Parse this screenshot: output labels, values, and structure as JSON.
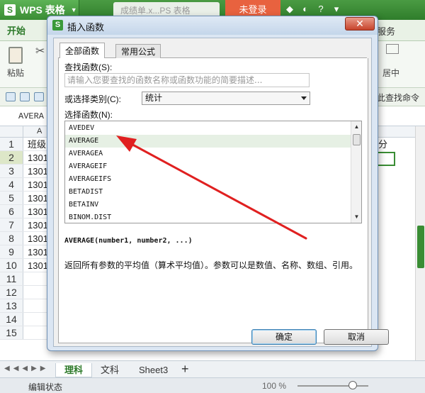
{
  "app": {
    "name": "WPS 表格",
    "logo_glyph": "S",
    "doc_tab": "成绩单.x...PS 表格",
    "login": "未登录",
    "accent": "#3a8d34"
  },
  "ribbon": {
    "tab_start": "开始",
    "tab_service": "服务",
    "paste": "粘贴",
    "center": "居中",
    "find_command": "此查找命令"
  },
  "formula": {
    "name_box": "AVERA"
  },
  "sheet": {
    "col_a": "A",
    "rows": [
      "1",
      "2",
      "3",
      "4",
      "5",
      "6",
      "7",
      "8",
      "9",
      "10",
      "11",
      "12",
      "13",
      "14",
      "15"
    ],
    "cells": [
      "班级",
      "1301",
      "1301",
      "1301",
      "1301",
      "1301",
      "1301",
      "1301",
      "1301",
      "1301"
    ],
    "right_header": "分",
    "tabs": [
      "理科",
      "文科",
      "Sheet3"
    ],
    "add": "+"
  },
  "status": {
    "mode": "编辑状态",
    "zoom": "100 %"
  },
  "dialog": {
    "title": "插入函数",
    "logo_glyph": "S",
    "close": "✕",
    "tabs": [
      "全部函数",
      "常用公式"
    ],
    "search_label": "查找函数(S):",
    "search_placeholder": "请输入您要查找的函数名称或函数功能的简要描述...",
    "category_label": "或选择类别(C):",
    "category_value": "统计",
    "function_label": "选择函数(N):",
    "functions": [
      "AVEDEV",
      "AVERAGE",
      "AVERAGEA",
      "AVERAGEIF",
      "AVERAGEIFS",
      "BETADIST",
      "BETAINV",
      "BINOM.DIST"
    ],
    "selected_function": "AVERAGE",
    "syntax": "AVERAGE(number1, number2, ...)",
    "description": "返回所有参数的平均值（算术平均值）。参数可以是数值、名称、数组、引用。",
    "ok": "确定",
    "cancel": "取消"
  },
  "annotation": {
    "arrow_color": "#e02020"
  }
}
